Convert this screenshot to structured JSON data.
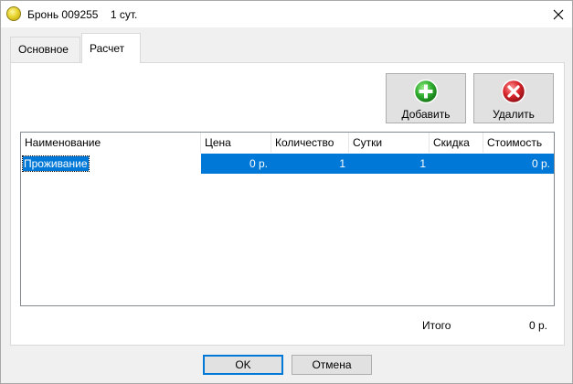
{
  "window": {
    "title": "Бронь 009255    1 сут."
  },
  "tabs": [
    {
      "label": "Основное",
      "active": false
    },
    {
      "label": "Расчет",
      "active": true
    }
  ],
  "toolbar": {
    "add_label": "Добавить",
    "delete_label": "Удалить"
  },
  "grid": {
    "columns": [
      "Наименование",
      "Цена",
      "Количество",
      "Сутки",
      "Скидка",
      "Стоимость"
    ],
    "rows": [
      {
        "name": "Проживание",
        "price": "0 р.",
        "quantity": "1",
        "days": "1",
        "discount": "",
        "cost": "0 р."
      }
    ]
  },
  "total": {
    "label": "Итого",
    "value": "0 р."
  },
  "buttons": {
    "ok_label": "OK",
    "cancel_label": "Отмена"
  },
  "colors": {
    "selection": "#0078d7",
    "add_icon": "#2fae2f",
    "delete_icon": "#d8242a"
  }
}
